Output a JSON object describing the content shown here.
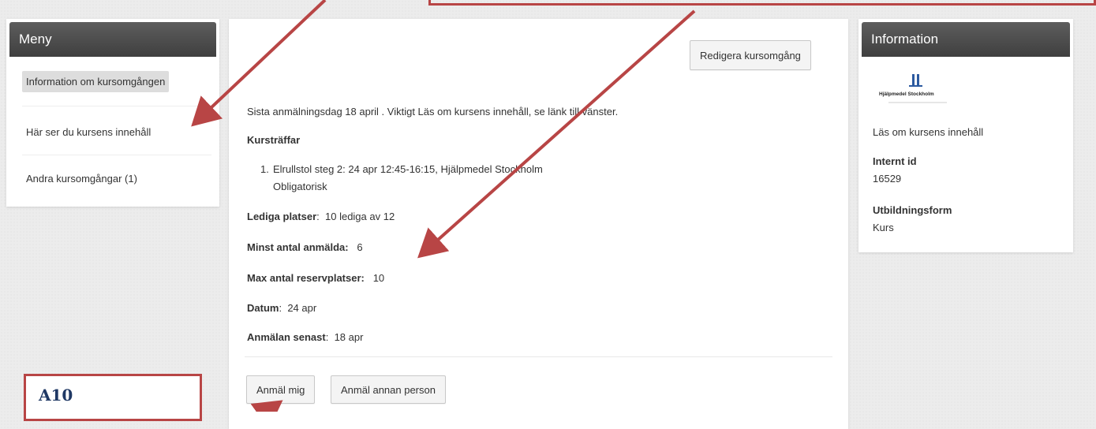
{
  "menu": {
    "title": "Meny",
    "items": [
      {
        "label": "Information om kursomgången"
      },
      {
        "label": "Här ser du kursens innehåll"
      },
      {
        "label": "Andra kursomgångar (1)"
      }
    ]
  },
  "main": {
    "edit_button": "Redigera kursomgång",
    "intro": "Sista anmälningsdag 18 april . Viktigt Läs om kursens innehåll, se länk till vänster.",
    "meetings_heading": "Kursträffar",
    "meeting": {
      "number": "1.",
      "text": "Elrullstol steg 2: 24 apr 12:45-16:15, Hjälpmedel Stockholm",
      "note": "Obligatorisk"
    },
    "fields": [
      {
        "label": "Lediga platser",
        "sep": ":",
        "value": "10 lediga av 12"
      },
      {
        "label": "Minst antal anmälda:",
        "sep": "",
        "value": "6"
      },
      {
        "label": "Max antal reservplatser:",
        "sep": "",
        "value": "10"
      },
      {
        "label": "Datum",
        "sep": ":",
        "value": "24 apr"
      },
      {
        "label": "Anmälan senast",
        "sep": ":",
        "value": "18 apr"
      }
    ],
    "register_button": "Anmäl mig",
    "register_other_button": "Anmäl annan person"
  },
  "info": {
    "title": "Information",
    "logo_text": "Hjälpmedel Stockholm",
    "link": "Läs om kursens innehåll",
    "internal_id_label": "Internt id",
    "internal_id_value": "16529",
    "form_label": "Utbildningsform",
    "form_value": "Kurs"
  },
  "annotation": {
    "label": "A10"
  },
  "colors": {
    "annotation_red": "#b84545",
    "header_dark": "#4a4a4a",
    "label_navy": "#1f3864"
  }
}
